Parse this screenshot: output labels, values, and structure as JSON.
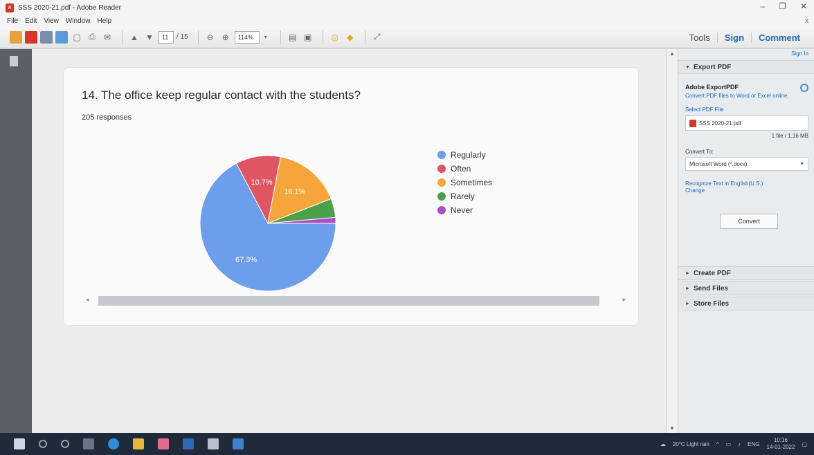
{
  "window": {
    "title": "SSS 2020-21.pdf - Adobe Reader",
    "controls": [
      "–",
      "❐",
      "✕"
    ]
  },
  "menu": {
    "items": [
      "File",
      "Edit",
      "View",
      "Window",
      "Help"
    ],
    "close": "x"
  },
  "toolbar": {
    "page_current": "11",
    "page_total": "/ 15",
    "zoom": "114%",
    "tools_label": "Tools",
    "sign_label": "Sign",
    "comment_label": "Comment"
  },
  "document": {
    "question": "14. The office keep regular contact with the students?",
    "responses": "205 responses"
  },
  "chart_data": {
    "type": "pie",
    "categories": [
      "Regularly",
      "Often",
      "Sometimes",
      "Rarely",
      "Never"
    ],
    "values": [
      67.3,
      10.7,
      16.1,
      4.5,
      1.4
    ],
    "slice_labels": [
      "67.3%",
      "10.7%",
      "16.1%",
      "",
      ""
    ],
    "colors": [
      "#6d9eeb",
      "#e05563",
      "#f6a53a",
      "#4ba14b",
      "#b04cc2"
    ],
    "legend": "right"
  },
  "right_pane": {
    "sign_in": "Sign In",
    "export_header": "Export PDF",
    "export_title": "Adobe ExportPDF",
    "export_desc": "Convert PDF files to Word or Excel online.",
    "select_label": "Select PDF File",
    "file_name": "SSS 2020-21.pdf",
    "file_count": "1 file / 1.16 MB",
    "convert_to_label": "Convert To:",
    "convert_option": "Microsoft Word (*.docx)",
    "recognize_text": "Recognize Text in English(U.S.)",
    "change_link": "Change",
    "convert_button": "Convert",
    "create_pdf": "Create PDF",
    "send_files": "Send Files",
    "store_files": "Store Files"
  },
  "taskbar": {
    "weather": "20°C  Light rain",
    "lang": "ENG",
    "time": "10:16",
    "date": "14-01-2022"
  }
}
